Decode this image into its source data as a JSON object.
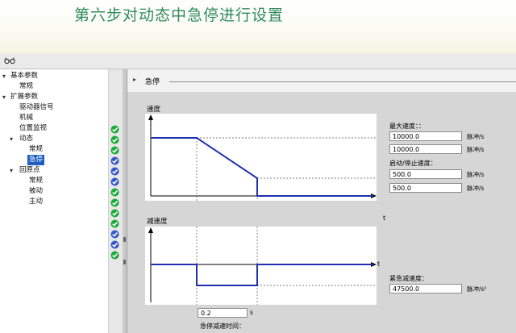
{
  "slide": {
    "title": "第六步对动态中急停进行设置"
  },
  "icons": {
    "toolbar": "glasses-icon",
    "status_ok": "green-check-icon",
    "status_partial": "blue-check-icon"
  },
  "colors": {
    "title_green": "#2f8a5c",
    "status_green": "#1aaa3a",
    "status_blue": "#3557c8",
    "selection_blue": "#1f5fbf",
    "curve_blue": "#1e2fb0"
  },
  "tree": {
    "items": [
      {
        "label": "基本参数",
        "level": 0,
        "expanded": true,
        "status": "green"
      },
      {
        "label": "常规",
        "level": 1,
        "status": "green"
      },
      {
        "label": "扩展参数",
        "level": 0,
        "expanded": true,
        "status": "green"
      },
      {
        "label": "驱动器信号",
        "level": 1,
        "status": "blue"
      },
      {
        "label": "机械",
        "level": 1,
        "status": "blue"
      },
      {
        "label": "位置监视",
        "level": 1,
        "status": "blue"
      },
      {
        "label": "动态",
        "level": 1,
        "expanded": true,
        "status": "green"
      },
      {
        "label": "常规",
        "level": 2,
        "status": "green"
      },
      {
        "label": "急停",
        "level": 2,
        "selected": true,
        "status": "green"
      },
      {
        "label": "回原点",
        "level": 1,
        "expanded": true,
        "status": "green"
      },
      {
        "label": "常规",
        "level": 2,
        "status": "blue"
      },
      {
        "label": "被动",
        "level": 2,
        "status": "blue"
      },
      {
        "label": "主动",
        "level": 2,
        "status": "green"
      }
    ]
  },
  "section": {
    "title": "急停"
  },
  "velocity_chart": {
    "ylabel": "速度",
    "xlabel": "t",
    "max_velocity_label": "最大速度：：",
    "max_velocity_value_1": "10000.0",
    "max_velocity_value_2": "10000.0",
    "start_stop_label": "启动/停止速度：",
    "start_stop_value_1": "500.0",
    "start_stop_value_2": "500.0",
    "unit": "脉冲/s"
  },
  "decel_chart": {
    "ylabel": "减速度",
    "xlabel": "t",
    "emergency_decel_label": "紧急减速度：",
    "emergency_decel_value": "47500.0",
    "unit": "脉冲/s²",
    "ramp_time_value": "0.2",
    "ramp_time_unit": "s",
    "ramp_time_label": "急停减速时间："
  }
}
